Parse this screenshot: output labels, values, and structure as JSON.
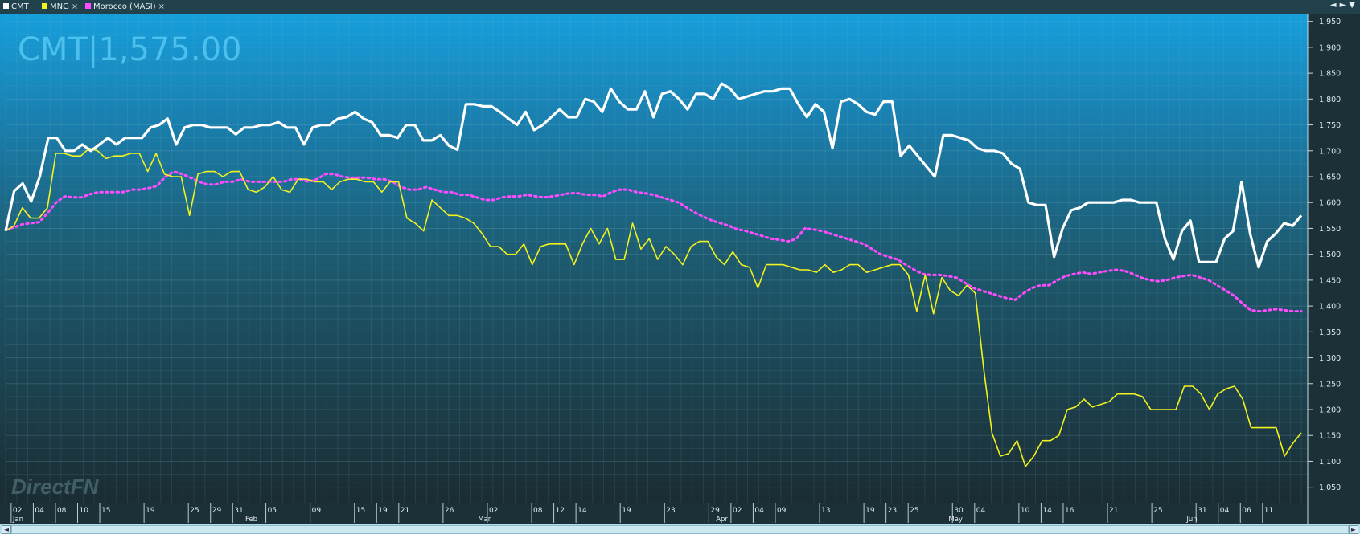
{
  "legend": {
    "items": [
      {
        "label": "CMT",
        "color": "#ffffff",
        "closable": false
      },
      {
        "label": "MNG",
        "color": "#f2f21e",
        "closable": true
      },
      {
        "label": "Morocco (MASI)",
        "color": "#ff4cff",
        "closable": true
      }
    ],
    "close_glyph": "×"
  },
  "controls": {
    "prev": "◄",
    "next": "►",
    "menu": "▼"
  },
  "watermark": "DirectFN",
  "scroll": {
    "left": "◄",
    "right": "►"
  },
  "chart_data": {
    "type": "line",
    "title": "CMT|1,575.00",
    "ylim": [
      1020,
      1965
    ],
    "y_axis_position": "right",
    "yticks": [
      1050,
      1100,
      1150,
      1200,
      1250,
      1300,
      1350,
      1400,
      1450,
      1500,
      1550,
      1600,
      1650,
      1700,
      1750,
      1800,
      1850,
      1900,
      1950
    ],
    "x_index_range": [
      0,
      234
    ],
    "day_ticks": [
      {
        "i": 1,
        "label": "02"
      },
      {
        "i": 5,
        "label": "04"
      },
      {
        "i": 9,
        "label": "08"
      },
      {
        "i": 13,
        "label": "10"
      },
      {
        "i": 17,
        "label": "15"
      },
      {
        "i": 25,
        "label": "19"
      },
      {
        "i": 33,
        "label": "25"
      },
      {
        "i": 37,
        "label": "29"
      },
      {
        "i": 41,
        "label": "31"
      },
      {
        "i": 47,
        "label": "05"
      },
      {
        "i": 55,
        "label": "09"
      },
      {
        "i": 63,
        "label": "15"
      },
      {
        "i": 67,
        "label": "19"
      },
      {
        "i": 71,
        "label": "21"
      },
      {
        "i": 79,
        "label": "26"
      },
      {
        "i": 87,
        "label": "02"
      },
      {
        "i": 95,
        "label": "08"
      },
      {
        "i": 99,
        "label": "12"
      },
      {
        "i": 103,
        "label": "14"
      },
      {
        "i": 111,
        "label": "19"
      },
      {
        "i": 119,
        "label": "23"
      },
      {
        "i": 127,
        "label": "29"
      },
      {
        "i": 131,
        "label": "02"
      },
      {
        "i": 135,
        "label": "04"
      },
      {
        "i": 139,
        "label": "09"
      },
      {
        "i": 147,
        "label": "13"
      },
      {
        "i": 155,
        "label": "19"
      },
      {
        "i": 159,
        "label": "23"
      },
      {
        "i": 163,
        "label": "25"
      },
      {
        "i": 171,
        "label": "30"
      },
      {
        "i": 175,
        "label": "04"
      },
      {
        "i": 183,
        "label": "10"
      },
      {
        "i": 187,
        "label": "14"
      },
      {
        "i": 191,
        "label": "16"
      },
      {
        "i": 199,
        "label": "21"
      },
      {
        "i": 207,
        "label": "25"
      },
      {
        "i": 215,
        "label": "31"
      },
      {
        "i": 219,
        "label": "04"
      },
      {
        "i": 223,
        "label": "06"
      },
      {
        "i": 227,
        "label": "11"
      }
    ],
    "month_ticks": [
      {
        "i": 1,
        "label": "Jan"
      },
      {
        "i": 43,
        "label": "Feb"
      },
      {
        "i": 85,
        "label": "Mar"
      },
      {
        "i": 128,
        "label": "Apr"
      },
      {
        "i": 170,
        "label": "May"
      },
      {
        "i": 213,
        "label": "Jun"
      }
    ],
    "series": [
      {
        "name": "CMT",
        "color": "#ffffff",
        "values": [
          1545,
          1622,
          1637,
          1602,
          1650,
          1725,
          1725,
          1700,
          1700,
          1712,
          1700,
          1712,
          1725,
          1712,
          1725,
          1725,
          1725,
          1745,
          1750,
          1762,
          1712,
          1745,
          1750,
          1750,
          1745,
          1745,
          1745,
          1732,
          1745,
          1745,
          1750,
          1750,
          1755,
          1745,
          1745,
          1712,
          1745,
          1750,
          1750,
          1762,
          1765,
          1775,
          1762,
          1755,
          1730,
          1730,
          1725,
          1750,
          1750,
          1720,
          1720,
          1730,
          1710,
          1702,
          1790,
          1790,
          1786,
          1786,
          1775,
          1762,
          1750,
          1775,
          1740,
          1750,
          1765,
          1780,
          1765,
          1765,
          1800,
          1795,
          1775,
          1820,
          1795,
          1780,
          1780,
          1815,
          1765,
          1810,
          1815,
          1800,
          1780,
          1810,
          1810,
          1800,
          1830,
          1820,
          1800,
          1805,
          1810,
          1815,
          1815,
          1820,
          1820,
          1790,
          1765,
          1790,
          1775,
          1705,
          1795,
          1800,
          1790,
          1775,
          1770,
          1795,
          1795,
          1690,
          1710,
          1690,
          1670,
          1650,
          1730,
          1730,
          1725,
          1720,
          1705,
          1700,
          1700,
          1695,
          1675,
          1665,
          1600,
          1595,
          1595,
          1495,
          1550,
          1585,
          1590,
          1600,
          1600,
          1600,
          1600,
          1605,
          1605,
          1600,
          1600,
          1600,
          1530,
          1490,
          1545,
          1565,
          1485,
          1485,
          1485,
          1530,
          1545,
          1640,
          1540,
          1475,
          1525,
          1540,
          1560,
          1555,
          1575
        ]
      },
      {
        "name": "MNG",
        "color": "#f2f21e",
        "values": [
          1545,
          1555,
          1590,
          1570,
          1570,
          1590,
          1695,
          1695,
          1690,
          1690,
          1705,
          1700,
          1685,
          1690,
          1690,
          1695,
          1695,
          1660,
          1695,
          1655,
          1650,
          1650,
          1575,
          1655,
          1660,
          1660,
          1650,
          1660,
          1660,
          1625,
          1620,
          1630,
          1650,
          1625,
          1620,
          1645,
          1645,
          1640,
          1640,
          1625,
          1640,
          1645,
          1645,
          1640,
          1640,
          1620,
          1640,
          1640,
          1570,
          1560,
          1545,
          1605,
          1590,
          1575,
          1575,
          1570,
          1560,
          1540,
          1515,
          1515,
          1500,
          1500,
          1520,
          1480,
          1515,
          1520,
          1520,
          1520,
          1480,
          1520,
          1550,
          1520,
          1550,
          1490,
          1490,
          1560,
          1510,
          1530,
          1490,
          1515,
          1500,
          1480,
          1515,
          1525,
          1525,
          1495,
          1480,
          1505,
          1480,
          1475,
          1435,
          1480,
          1480,
          1480,
          1475,
          1470,
          1470,
          1465,
          1480,
          1465,
          1470,
          1480,
          1480,
          1465,
          1470,
          1475,
          1480,
          1480,
          1460,
          1390,
          1460,
          1385,
          1455,
          1430,
          1420,
          1440,
          1425,
          1280,
          1155,
          1110,
          1115,
          1140,
          1090,
          1110,
          1140,
          1140,
          1150,
          1200,
          1205,
          1220,
          1205,
          1210,
          1215,
          1230,
          1230,
          1230,
          1225,
          1200,
          1200,
          1200,
          1200,
          1245,
          1245,
          1230,
          1200,
          1230,
          1240,
          1245,
          1220,
          1165,
          1165,
          1165,
          1165,
          1110,
          1135,
          1155
        ]
      },
      {
        "name": "Morocco (MASI)",
        "color": "#ff4cff",
        "values": [
          1548,
          1552,
          1558,
          1560,
          1562,
          1580,
          1600,
          1612,
          1610,
          1610,
          1616,
          1620,
          1620,
          1620,
          1620,
          1625,
          1625,
          1628,
          1632,
          1650,
          1660,
          1655,
          1648,
          1640,
          1635,
          1635,
          1640,
          1640,
          1645,
          1640,
          1640,
          1640,
          1640,
          1640,
          1645,
          1645,
          1640,
          1645,
          1655,
          1655,
          1650,
          1648,
          1648,
          1648,
          1645,
          1645,
          1640,
          1630,
          1625,
          1625,
          1630,
          1625,
          1620,
          1620,
          1615,
          1615,
          1610,
          1605,
          1605,
          1610,
          1612,
          1612,
          1615,
          1612,
          1610,
          1612,
          1615,
          1618,
          1618,
          1615,
          1615,
          1612,
          1620,
          1625,
          1625,
          1620,
          1618,
          1615,
          1610,
          1605,
          1600,
          1590,
          1580,
          1572,
          1565,
          1560,
          1555,
          1548,
          1545,
          1540,
          1535,
          1530,
          1528,
          1525,
          1530,
          1550,
          1548,
          1545,
          1540,
          1535,
          1530,
          1525,
          1520,
          1510,
          1500,
          1495,
          1490,
          1480,
          1470,
          1462,
          1460,
          1460,
          1458,
          1455,
          1445,
          1435,
          1430,
          1425,
          1420,
          1415,
          1412,
          1425,
          1435,
          1440,
          1440,
          1450,
          1458,
          1462,
          1465,
          1462,
          1465,
          1468,
          1470,
          1468,
          1462,
          1455,
          1450,
          1448,
          1450,
          1455,
          1458,
          1460,
          1455,
          1450,
          1440,
          1430,
          1420,
          1405,
          1392,
          1390,
          1392,
          1394,
          1392,
          1390,
          1390
        ]
      }
    ]
  }
}
